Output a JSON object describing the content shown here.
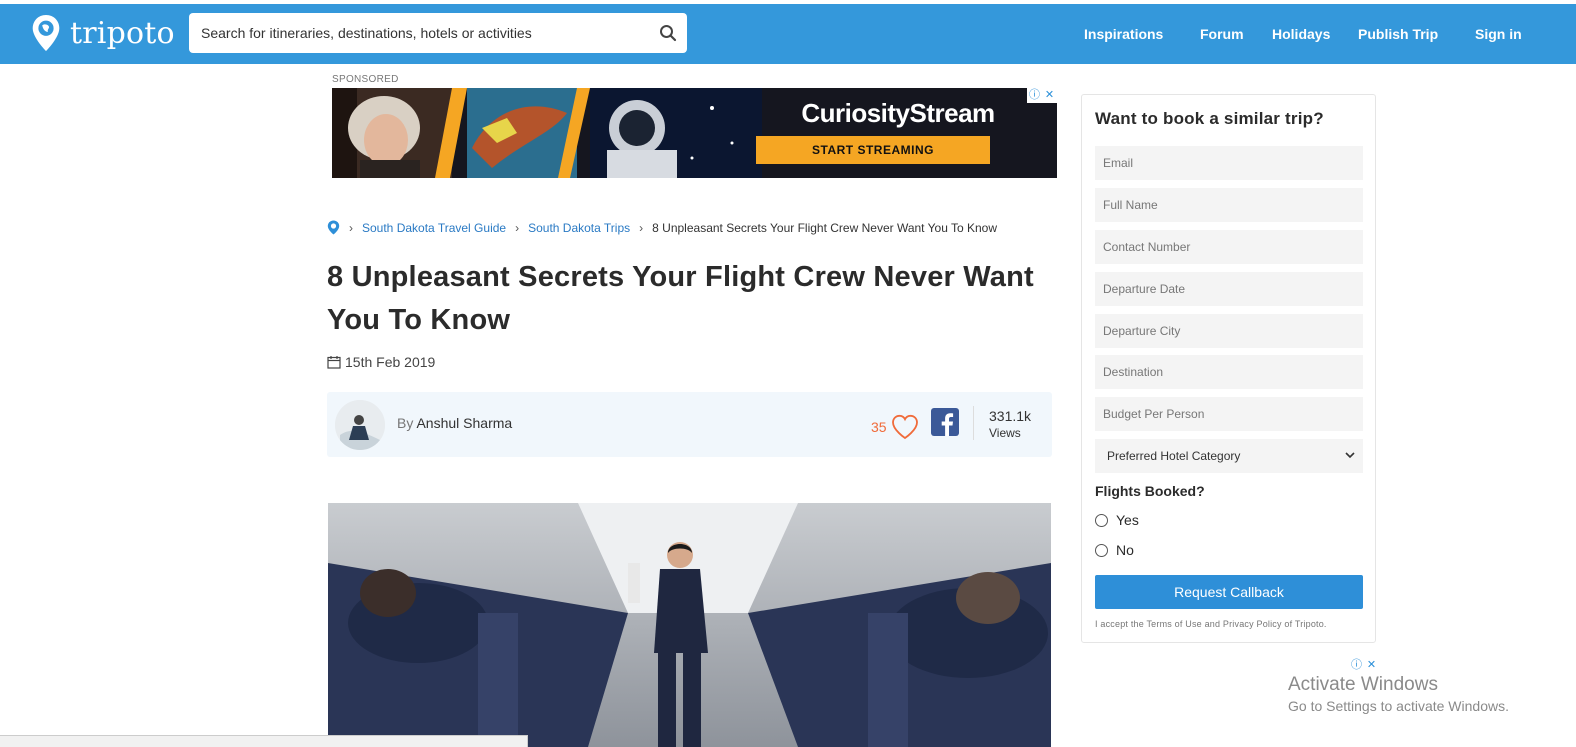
{
  "header": {
    "brand": "tripoto",
    "search_placeholder": "Search for itineraries, destinations, hotels or activities",
    "nav": [
      "Inspirations",
      "Forum",
      "Holidays",
      "Publish Trip",
      "Sign in"
    ]
  },
  "ad": {
    "sponsored_label": "SPONSORED",
    "brand": "CuriosityStream",
    "cta": "START STREAMING"
  },
  "breadcrumb": {
    "items": [
      "South Dakota Travel Guide",
      "South Dakota Trips"
    ],
    "current": "8 Unpleasant Secrets Your Flight Crew Never Want You To Know"
  },
  "article": {
    "title": "8 Unpleasant Secrets Your Flight Crew Never Want You To Know",
    "date": "15th Feb 2019",
    "by_label": "By",
    "author": "Anshul Sharma",
    "likes": "35",
    "views_count": "331.1k",
    "views_label": "Views"
  },
  "booking": {
    "title": "Want to book a similar trip?",
    "fields": [
      "Email",
      "Full Name",
      "Contact Number",
      "Departure Date",
      "Departure City",
      "Destination",
      "Budget Per Person"
    ],
    "hotel_select": "Preferred Hotel Category",
    "flights_label": "Flights Booked?",
    "options": [
      "Yes",
      "No"
    ],
    "submit": "Request Callback",
    "terms": "I accept the Terms of Use and Privacy Policy of Tripoto."
  },
  "os_overlay": {
    "line1": "Activate Windows",
    "line2": "Go to Settings to activate Windows."
  },
  "colors": {
    "header": "#3498db",
    "accent_link": "#2a7ac4",
    "like": "#f06b3a",
    "ad_button": "#f5a623"
  }
}
